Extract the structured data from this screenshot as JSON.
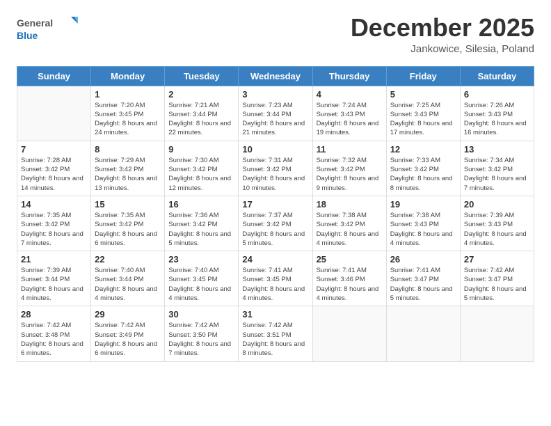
{
  "header": {
    "logo_general": "General",
    "logo_blue": "Blue",
    "month_title": "December 2025",
    "location": "Jankowice, Silesia, Poland"
  },
  "days_of_week": [
    "Sunday",
    "Monday",
    "Tuesday",
    "Wednesday",
    "Thursday",
    "Friday",
    "Saturday"
  ],
  "weeks": [
    [
      {
        "day": "",
        "sunrise": "",
        "sunset": "",
        "daylight": ""
      },
      {
        "day": "1",
        "sunrise": "Sunrise: 7:20 AM",
        "sunset": "Sunset: 3:45 PM",
        "daylight": "Daylight: 8 hours and 24 minutes."
      },
      {
        "day": "2",
        "sunrise": "Sunrise: 7:21 AM",
        "sunset": "Sunset: 3:44 PM",
        "daylight": "Daylight: 8 hours and 22 minutes."
      },
      {
        "day": "3",
        "sunrise": "Sunrise: 7:23 AM",
        "sunset": "Sunset: 3:44 PM",
        "daylight": "Daylight: 8 hours and 21 minutes."
      },
      {
        "day": "4",
        "sunrise": "Sunrise: 7:24 AM",
        "sunset": "Sunset: 3:43 PM",
        "daylight": "Daylight: 8 hours and 19 minutes."
      },
      {
        "day": "5",
        "sunrise": "Sunrise: 7:25 AM",
        "sunset": "Sunset: 3:43 PM",
        "daylight": "Daylight: 8 hours and 17 minutes."
      },
      {
        "day": "6",
        "sunrise": "Sunrise: 7:26 AM",
        "sunset": "Sunset: 3:43 PM",
        "daylight": "Daylight: 8 hours and 16 minutes."
      }
    ],
    [
      {
        "day": "7",
        "sunrise": "Sunrise: 7:28 AM",
        "sunset": "Sunset: 3:42 PM",
        "daylight": "Daylight: 8 hours and 14 minutes."
      },
      {
        "day": "8",
        "sunrise": "Sunrise: 7:29 AM",
        "sunset": "Sunset: 3:42 PM",
        "daylight": "Daylight: 8 hours and 13 minutes."
      },
      {
        "day": "9",
        "sunrise": "Sunrise: 7:30 AM",
        "sunset": "Sunset: 3:42 PM",
        "daylight": "Daylight: 8 hours and 12 minutes."
      },
      {
        "day": "10",
        "sunrise": "Sunrise: 7:31 AM",
        "sunset": "Sunset: 3:42 PM",
        "daylight": "Daylight: 8 hours and 10 minutes."
      },
      {
        "day": "11",
        "sunrise": "Sunrise: 7:32 AM",
        "sunset": "Sunset: 3:42 PM",
        "daylight": "Daylight: 8 hours and 9 minutes."
      },
      {
        "day": "12",
        "sunrise": "Sunrise: 7:33 AM",
        "sunset": "Sunset: 3:42 PM",
        "daylight": "Daylight: 8 hours and 8 minutes."
      },
      {
        "day": "13",
        "sunrise": "Sunrise: 7:34 AM",
        "sunset": "Sunset: 3:42 PM",
        "daylight": "Daylight: 8 hours and 7 minutes."
      }
    ],
    [
      {
        "day": "14",
        "sunrise": "Sunrise: 7:35 AM",
        "sunset": "Sunset: 3:42 PM",
        "daylight": "Daylight: 8 hours and 7 minutes."
      },
      {
        "day": "15",
        "sunrise": "Sunrise: 7:35 AM",
        "sunset": "Sunset: 3:42 PM",
        "daylight": "Daylight: 8 hours and 6 minutes."
      },
      {
        "day": "16",
        "sunrise": "Sunrise: 7:36 AM",
        "sunset": "Sunset: 3:42 PM",
        "daylight": "Daylight: 8 hours and 5 minutes."
      },
      {
        "day": "17",
        "sunrise": "Sunrise: 7:37 AM",
        "sunset": "Sunset: 3:42 PM",
        "daylight": "Daylight: 8 hours and 5 minutes."
      },
      {
        "day": "18",
        "sunrise": "Sunrise: 7:38 AM",
        "sunset": "Sunset: 3:42 PM",
        "daylight": "Daylight: 8 hours and 4 minutes."
      },
      {
        "day": "19",
        "sunrise": "Sunrise: 7:38 AM",
        "sunset": "Sunset: 3:43 PM",
        "daylight": "Daylight: 8 hours and 4 minutes."
      },
      {
        "day": "20",
        "sunrise": "Sunrise: 7:39 AM",
        "sunset": "Sunset: 3:43 PM",
        "daylight": "Daylight: 8 hours and 4 minutes."
      }
    ],
    [
      {
        "day": "21",
        "sunrise": "Sunrise: 7:39 AM",
        "sunset": "Sunset: 3:44 PM",
        "daylight": "Daylight: 8 hours and 4 minutes."
      },
      {
        "day": "22",
        "sunrise": "Sunrise: 7:40 AM",
        "sunset": "Sunset: 3:44 PM",
        "daylight": "Daylight: 8 hours and 4 minutes."
      },
      {
        "day": "23",
        "sunrise": "Sunrise: 7:40 AM",
        "sunset": "Sunset: 3:45 PM",
        "daylight": "Daylight: 8 hours and 4 minutes."
      },
      {
        "day": "24",
        "sunrise": "Sunrise: 7:41 AM",
        "sunset": "Sunset: 3:45 PM",
        "daylight": "Daylight: 8 hours and 4 minutes."
      },
      {
        "day": "25",
        "sunrise": "Sunrise: 7:41 AM",
        "sunset": "Sunset: 3:46 PM",
        "daylight": "Daylight: 8 hours and 4 minutes."
      },
      {
        "day": "26",
        "sunrise": "Sunrise: 7:41 AM",
        "sunset": "Sunset: 3:47 PM",
        "daylight": "Daylight: 8 hours and 5 minutes."
      },
      {
        "day": "27",
        "sunrise": "Sunrise: 7:42 AM",
        "sunset": "Sunset: 3:47 PM",
        "daylight": "Daylight: 8 hours and 5 minutes."
      }
    ],
    [
      {
        "day": "28",
        "sunrise": "Sunrise: 7:42 AM",
        "sunset": "Sunset: 3:48 PM",
        "daylight": "Daylight: 8 hours and 6 minutes."
      },
      {
        "day": "29",
        "sunrise": "Sunrise: 7:42 AM",
        "sunset": "Sunset: 3:49 PM",
        "daylight": "Daylight: 8 hours and 6 minutes."
      },
      {
        "day": "30",
        "sunrise": "Sunrise: 7:42 AM",
        "sunset": "Sunset: 3:50 PM",
        "daylight": "Daylight: 8 hours and 7 minutes."
      },
      {
        "day": "31",
        "sunrise": "Sunrise: 7:42 AM",
        "sunset": "Sunset: 3:51 PM",
        "daylight": "Daylight: 8 hours and 8 minutes."
      },
      {
        "day": "",
        "sunrise": "",
        "sunset": "",
        "daylight": ""
      },
      {
        "day": "",
        "sunrise": "",
        "sunset": "",
        "daylight": ""
      },
      {
        "day": "",
        "sunrise": "",
        "sunset": "",
        "daylight": ""
      }
    ]
  ]
}
